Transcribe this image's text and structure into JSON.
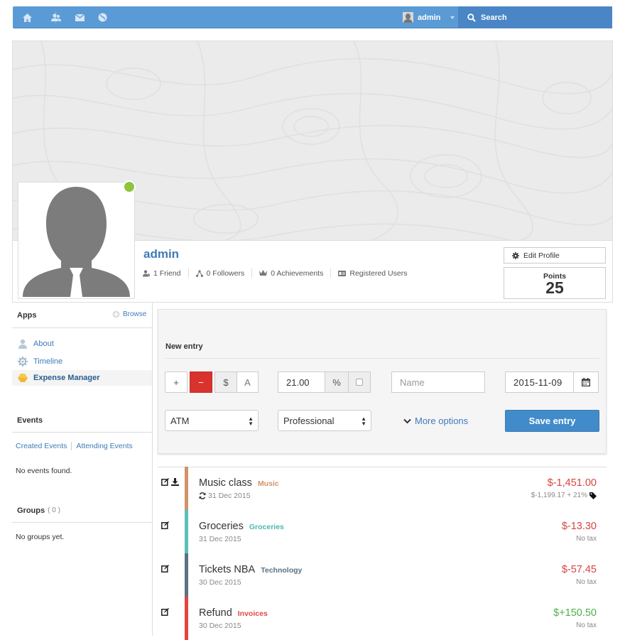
{
  "topbar": {
    "icons": [
      "home-icon",
      "friends-icon",
      "mail-icon",
      "globe-icon"
    ],
    "username": "admin",
    "search_label": "Search"
  },
  "profile": {
    "name": "admin",
    "online": true,
    "stats": {
      "friends": "1 Friend",
      "followers": "0 Followers",
      "achievements": "0 Achievements",
      "group": "Registered Users"
    },
    "edit_label": "Edit Profile",
    "points_label": "Points",
    "points_value": "25"
  },
  "sidebar": {
    "apps_title": "Apps",
    "browse_label": "Browse",
    "apps": [
      {
        "label": "About",
        "icon": "person-icon"
      },
      {
        "label": "Timeline",
        "icon": "gear-icon"
      },
      {
        "label": "Expense Manager",
        "icon": "hexagon-icon"
      }
    ],
    "events_title": "Events",
    "events_tabs": [
      "Created Events",
      "Attending Events"
    ],
    "events_empty": "No events found.",
    "groups_title": "Groups",
    "groups_count": "( 0 )",
    "groups_empty": "No groups yet."
  },
  "new_entry": {
    "title": "New entry",
    "plus_label": "+",
    "minus_label": "−",
    "dollar_label": "$",
    "a_label": "A",
    "amount_value": "21.00",
    "percent_label": "%",
    "name_placeholder": "Name",
    "date_value": "2015-11-09",
    "method": "ATM",
    "category": "Professional",
    "more_options": "More options",
    "save_label": "Save entry"
  },
  "entries": [
    {
      "name": "Music class",
      "category": "Music",
      "category_color": "#d0936a",
      "bar_color": "#d0936a",
      "date": "31 Dec 2015",
      "recurring": true,
      "download": true,
      "amount": "$-1,451.00",
      "amount_color": "#d64541",
      "tax": "$-1,199.17 + 21%",
      "tax_tag": true
    },
    {
      "name": "Groceries",
      "category": "Groceries",
      "category_color": "#4fb6b0",
      "bar_color": "#5bbfb9",
      "date": "31 Dec 2015",
      "recurring": false,
      "download": false,
      "amount": "$-13.30",
      "amount_color": "#d64541",
      "tax": "No tax",
      "tax_tag": false
    },
    {
      "name": "Tickets NBA",
      "category": "Technology",
      "category_color": "#5a7083",
      "bar_color": "#5d7283",
      "date": "30 Dec 2015",
      "recurring": false,
      "download": false,
      "amount": "$-57.45",
      "amount_color": "#d64541",
      "tax": "No tax",
      "tax_tag": false
    },
    {
      "name": "Refund",
      "category": "Invoices",
      "category_color": "#e04848",
      "bar_color": "#e2453f",
      "date": "30 Dec 2015",
      "recurring": false,
      "download": false,
      "amount": "$+150.50",
      "amount_color": "#4fae4c",
      "tax": "No tax",
      "tax_tag": false
    }
  ]
}
